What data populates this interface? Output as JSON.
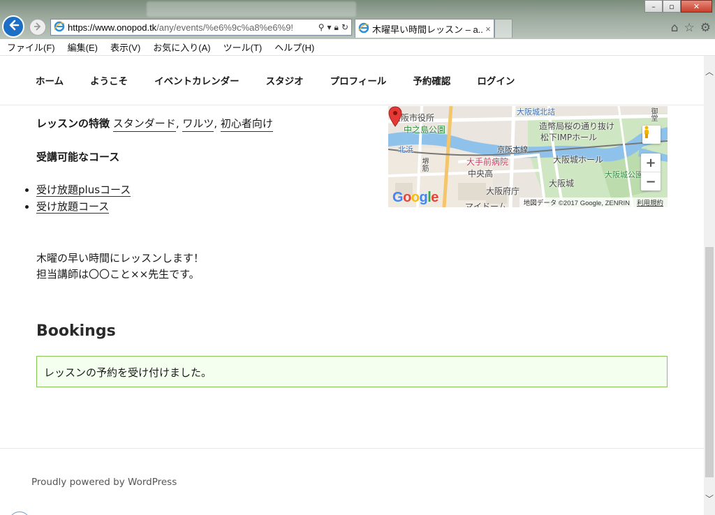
{
  "browser": {
    "url_host": "https://www.onopod.tk",
    "url_rest": "/any/events/%e6%9c%a8%e6%9!",
    "tab_title": "木曜早い時間レッスン – a...",
    "tab_close": "×",
    "window_controls": {
      "minimize": "–",
      "maximize": "▫",
      "close": "✕"
    },
    "tools": {
      "home": "⌂",
      "favorites": "☆",
      "settings": "⚙"
    }
  },
  "menubar": [
    "ファイル(F)",
    "編集(E)",
    "表示(V)",
    "お気に入り(A)",
    "ツール(T)",
    "ヘルプ(H)"
  ],
  "nav": [
    "ホーム",
    "ようこそ",
    "イベントカレンダー",
    "スタジオ",
    "プロフィール",
    "予約確認",
    "ログイン"
  ],
  "lesson": {
    "features_label": "レッスンの特徴",
    "features": [
      "スタンダード",
      "ワルツ",
      "初心者向け"
    ],
    "courses_title": "受講可能なコース",
    "courses": [
      "受け放題plusコース",
      "受け放題コース"
    ],
    "description": [
      "木曜の早い時間にレッスンします！",
      "担当講師は〇〇こと××先生です。"
    ]
  },
  "bookings": {
    "title": "Bookings",
    "notice": "レッスンの予約を受け付けました。"
  },
  "footer": {
    "credit": "Proudly powered by WordPress"
  },
  "map": {
    "labels": {
      "city_hall": "大阪市役所",
      "park": "中之島公園",
      "kitahama": "北浜",
      "hospital": "大手前病院",
      "school": "中央高",
      "pref": "大阪府庁",
      "dome": "マイドーム",
      "station": "大阪城北詰",
      "mint": "造幣局桜の通り抜け",
      "imp": "松下IMPホール",
      "hall": "大阪城ホール",
      "park2": "大阪城公園",
      "castle": "大阪城",
      "line": "京阪本線",
      "road1": "堺筋",
      "road2": "御堂"
    },
    "attribution": "地図データ ©2017 Google, ZENRIN",
    "terms": "利用規約",
    "google": "Google",
    "zoom_in": "+",
    "zoom_out": "−"
  },
  "colors": {
    "notice_bg": "#f5fff0",
    "notice_border": "#86c455",
    "link_underline": "#333333"
  }
}
